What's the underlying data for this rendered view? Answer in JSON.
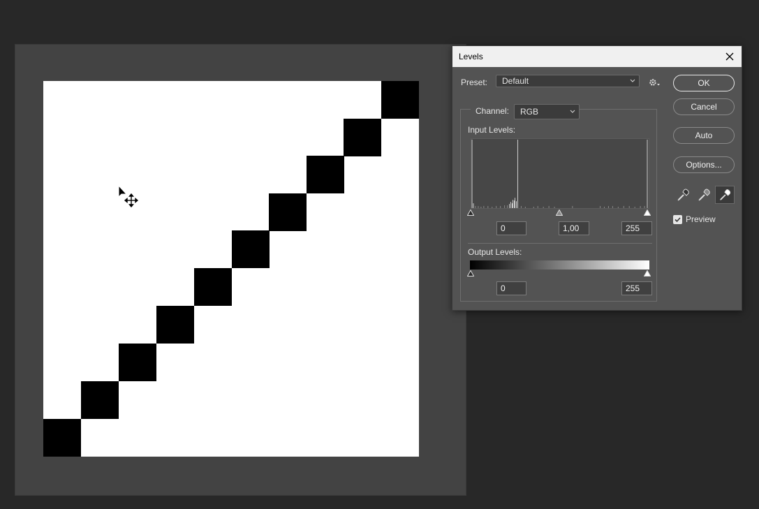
{
  "dialog": {
    "title": "Levels",
    "preset_label": "Preset:",
    "preset_value": "Default",
    "channel_label": "Channel:",
    "channel_value": "RGB",
    "input_levels_label": "Input Levels:",
    "input_black": "0",
    "input_gamma": "1,00",
    "input_white": "255",
    "output_levels_label": "Output Levels:",
    "output_black": "0",
    "output_white": "255",
    "preview_label": "Preview",
    "preview_checked": true
  },
  "buttons": {
    "ok": "OK",
    "cancel": "Cancel",
    "auto": "Auto",
    "options": "Options..."
  },
  "icons": {
    "close": "close-icon",
    "preset_gear": "gear-icon",
    "eyedroppers": [
      "black-point-eyedropper-icon",
      "gray-point-eyedropper-icon",
      "white-point-eyedropper-icon"
    ],
    "cursor": "move-cursor-icon"
  },
  "colors": {
    "dialog_bg": "#535353",
    "workspace_bg": "#282828",
    "pasteboard_bg": "#434343"
  }
}
